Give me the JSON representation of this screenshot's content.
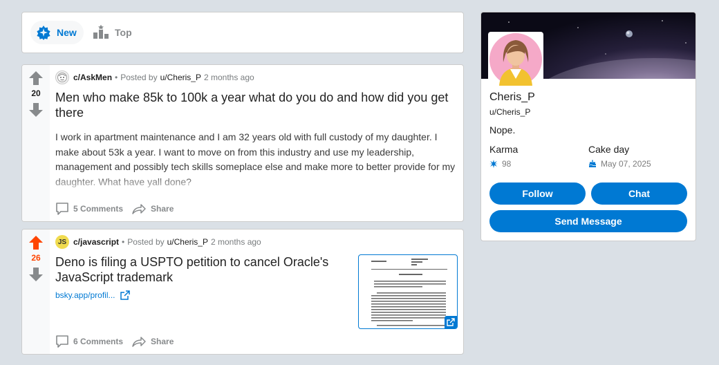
{
  "sort": {
    "new_label": "New",
    "top_label": "Top"
  },
  "posts": [
    {
      "subreddit": "c/AskMen",
      "posted_by": "Posted by",
      "user": "u/Cheris_P",
      "time": "2 months ago",
      "votes": "20",
      "title": "Men who make 85k to 100k a year what do you do and how did you get there",
      "excerpt": "I work in apartment maintenance and I am 32 years old with full custody of my daughter. I make about 53k a year. I want to move on from this industry and use my leadership, management and possibly tech skills someplace else and make more to better provide for my daughter. What have yall done?",
      "comments": "5 Comments",
      "share": "Share"
    },
    {
      "subreddit": "c/javascript",
      "sub_icon_text": "JS",
      "posted_by": "Posted by",
      "user": "u/Cheris_P",
      "time": "2 months ago",
      "votes": "26",
      "title": "Deno is filing a USPTO petition to cancel Oracle's JavaScript trademark",
      "link": "bsky.app/profil...",
      "comments": "6 Comments",
      "share": "Share"
    }
  ],
  "profile": {
    "name": "Cheris_P",
    "handle": "u/Cheris_P",
    "bio": "Nope.",
    "karma_label": "Karma",
    "karma_value": "98",
    "cakeday_label": "Cake day",
    "cakeday_value": "May 07, 2025",
    "follow_label": "Follow",
    "chat_label": "Chat",
    "message_label": "Send Message"
  },
  "colors": {
    "accent": "#0079d3",
    "upvote_active": "#ff4500",
    "vote_gray": "#878a8c"
  }
}
